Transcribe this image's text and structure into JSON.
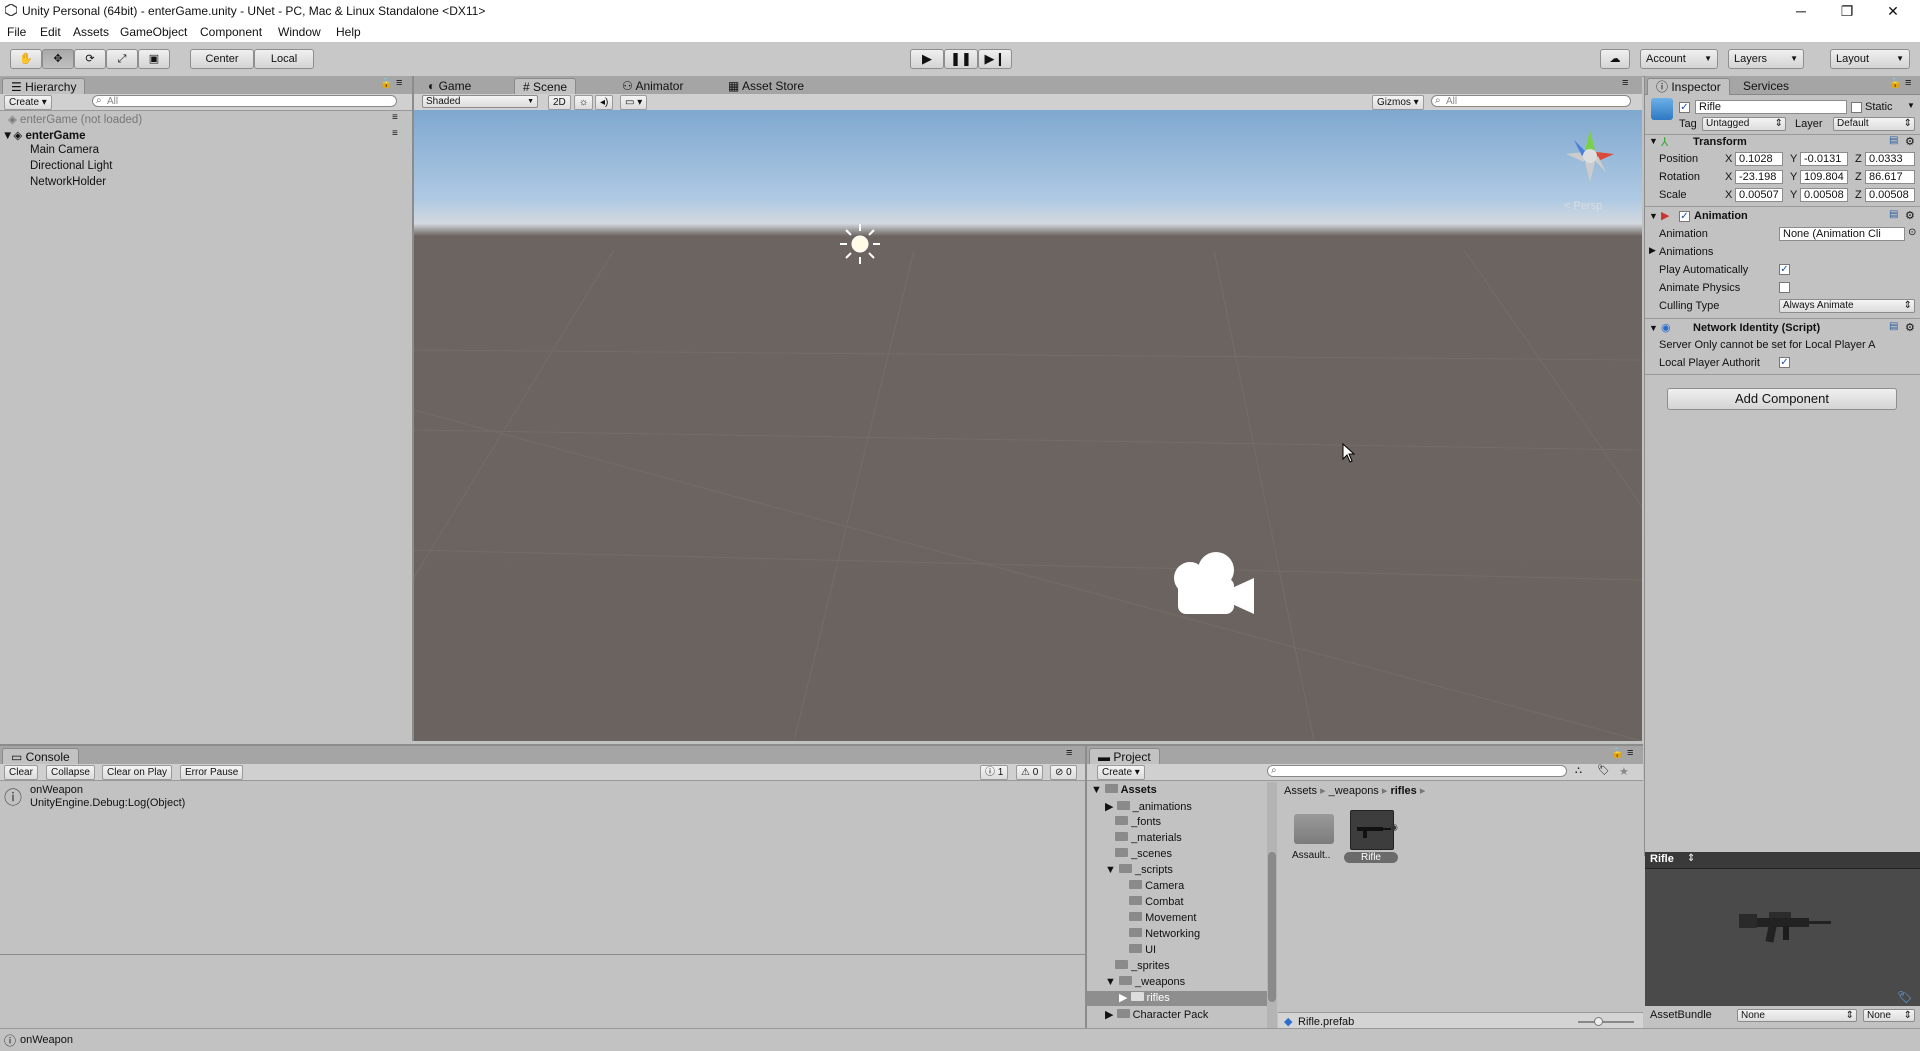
{
  "window": {
    "title": "Unity Personal (64bit) - enterGame.unity - UNet - PC, Mac & Linux Standalone <DX11>",
    "minimize": "─",
    "maximize": "❐",
    "close": "✕"
  },
  "menu": [
    "File",
    "Edit",
    "Assets",
    "GameObject",
    "Component",
    "Window",
    "Help"
  ],
  "toolbar": {
    "pivot": "Center",
    "space": "Local",
    "account": "Account",
    "layers": "Layers",
    "layout": "Layout"
  },
  "hierarchy": {
    "tab": "Hierarchy",
    "create": "Create",
    "search_placeholder": "All",
    "scenes": [
      {
        "name": "enterGame (not loaded)",
        "bold": false
      },
      {
        "name": "enterGame",
        "bold": true
      }
    ],
    "items": [
      "Main Camera",
      "Directional Light",
      "NetworkHolder"
    ]
  },
  "scene_tabs": {
    "game": "Game",
    "scene": "Scene",
    "animator": "Animator",
    "asset_store": "Asset Store"
  },
  "scene_bar": {
    "shading": "Shaded",
    "mode2d": "2D",
    "gizmos": "Gizmos",
    "search_placeholder": "All",
    "persp": "< Persp"
  },
  "inspector": {
    "tab": "Inspector",
    "services_tab": "Services",
    "object_name": "Rifle",
    "static_label": "Static",
    "tag_label": "Tag",
    "tag_value": "Untagged",
    "layer_label": "Layer",
    "layer_value": "Default",
    "transform": {
      "title": "Transform",
      "position": {
        "label": "Position",
        "x": "0.1028",
        "y": "-0.0131",
        "z": "0.0333"
      },
      "rotation": {
        "label": "Rotation",
        "x": "-23.198",
        "y": "109.804",
        "z": "86.617"
      },
      "scale": {
        "label": "Scale",
        "x": "0.00507",
        "y": "0.00508",
        "z": "0.00508"
      }
    },
    "animation": {
      "title": "Animation",
      "clip_label": "Animation",
      "clip_value": "None (Animation Cli",
      "animations_label": "Animations",
      "play_auto_label": "Play Automatically",
      "play_auto": true,
      "physics_label": "Animate Physics",
      "physics": false,
      "culling_label": "Culling Type",
      "culling_value": "Always Animate"
    },
    "network": {
      "title": "Network Identity (Script)",
      "server_only": "Server Only cannot be set for Local Player A",
      "local_label": "Local Player Authorit",
      "local": true
    },
    "add_component": "Add Component"
  },
  "console": {
    "tab": "Console",
    "clear": "Clear",
    "collapse": "Collapse",
    "clear_on_play": "Clear on Play",
    "error_pause": "Error Pause",
    "info_count": "1",
    "warn_count": "0",
    "error_count": "0",
    "entry_line1": "onWeapon",
    "entry_line2": "UnityEngine.Debug:Log(Object)"
  },
  "project": {
    "tab": "Project",
    "create": "Create",
    "tree": [
      {
        "name": "Assets",
        "depth": 0,
        "bold": true
      },
      {
        "name": "_animations",
        "depth": 1
      },
      {
        "name": "_fonts",
        "depth": 1
      },
      {
        "name": "_materials",
        "depth": 1
      },
      {
        "name": "_scenes",
        "depth": 1
      },
      {
        "name": "_scripts",
        "depth": 1
      },
      {
        "name": "Camera",
        "depth": 2
      },
      {
        "name": "Combat",
        "depth": 2
      },
      {
        "name": "Movement",
        "depth": 2
      },
      {
        "name": "Networking",
        "depth": 2
      },
      {
        "name": "UI",
        "depth": 2
      },
      {
        "name": "_sprites",
        "depth": 1
      },
      {
        "name": "_weapons",
        "depth": 1
      },
      {
        "name": "rifles",
        "depth": 2,
        "selected": true
      },
      {
        "name": "Character Pack",
        "depth": 1
      }
    ],
    "breadcrumb": [
      "Assets",
      "_weapons",
      "rifles"
    ],
    "assets": [
      {
        "name": "Assault..",
        "kind": "folder"
      },
      {
        "name": "Rifle",
        "kind": "prefab"
      }
    ],
    "selected_file": "Rifle.prefab"
  },
  "preview": {
    "title": "Rifle",
    "assetbundle_label": "AssetBundle",
    "bundle_value": "None",
    "variant_value": "None"
  },
  "status": {
    "message": "onWeapon"
  }
}
